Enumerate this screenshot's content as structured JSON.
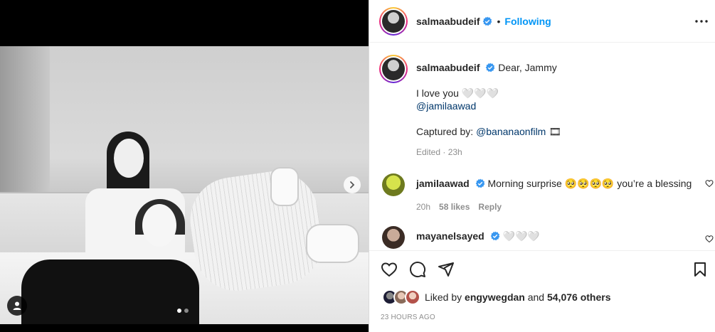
{
  "post": {
    "dots_total": 2,
    "dots_active": 0
  },
  "header": {
    "username": "salmaabudeif",
    "separator": "•",
    "follow_state": "Following"
  },
  "caption": {
    "username": "salmaabudeif",
    "first_line": "Dear, Jammy",
    "line2": "I love you 🤍🤍🤍",
    "mention": "@jamilaawad",
    "captured_label": "Captured by: ",
    "captured_mention": "@bananaonfilm",
    "captured_suffix": " 🎞",
    "edited": "Edited · 23h"
  },
  "comments": [
    {
      "username": "jamilaawad",
      "text": "Morning surprise 🥺🥺🥺🥺 you’re a blessing",
      "time": "20h",
      "likes": "58 likes",
      "reply": "Reply",
      "avatar_color": "#c7d93a"
    },
    {
      "username": "mayanelsayed",
      "text": "🤍🤍🤍",
      "avatar_color": "#b59a8a"
    }
  ],
  "likes": {
    "prefix": "Liked by ",
    "user": "engywegdan",
    "middle": " and ",
    "count": "54,076 others"
  },
  "timestamp": "23 HOURS AGO",
  "colors": {
    "accent": "#0095f6",
    "link": "#00376b",
    "muted": "#8e8e8e"
  }
}
